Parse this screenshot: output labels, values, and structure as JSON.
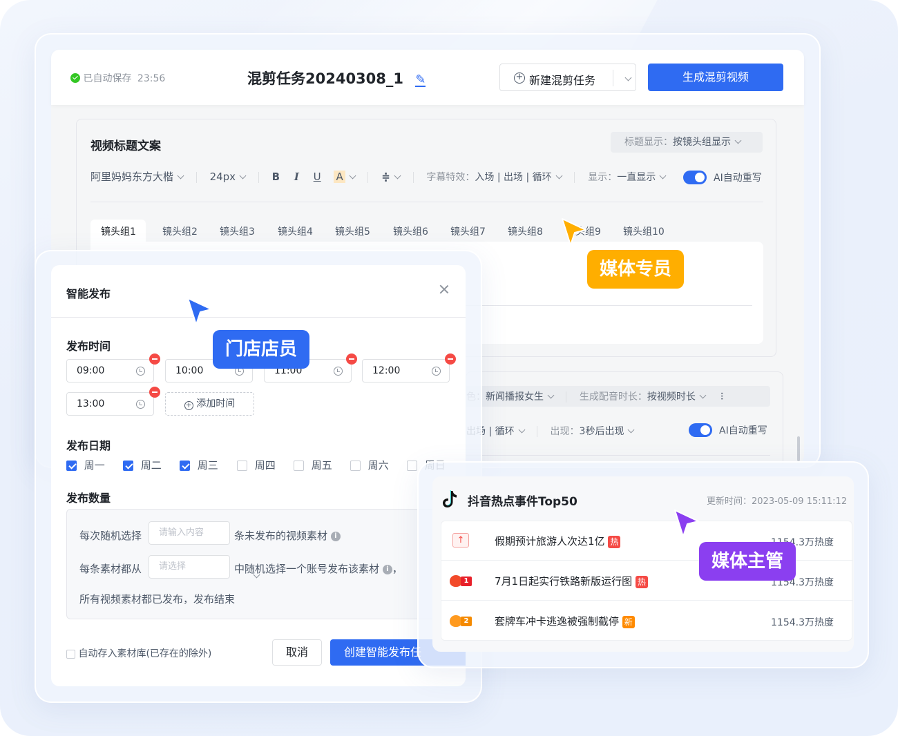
{
  "colors": {
    "primary": "#2f6bf2",
    "media_specialist": "#ffae00",
    "store_clerk": "#2f6bf2",
    "media_manager": "#8b3ff0",
    "danger": "#f54a45",
    "save_ok": "#34c724"
  },
  "header": {
    "autosave_text": "已自动保存",
    "autosave_time": "23:56",
    "task_title": "混剪任务20240308_1",
    "new_task_label": "新建混剪任务",
    "generate_label": "生成混剪视频"
  },
  "title_section": {
    "heading": "视频标题文案",
    "display_mode_label": "标题显示：",
    "display_mode_value": "按镜头组显示",
    "font_family": "阿里妈妈东方大楷",
    "font_size": "24px",
    "format_buttons": [
      "B",
      "I",
      "U",
      "A"
    ],
    "effect_label": "字幕特效：",
    "effect_value": "入场 | 出场 | 循环",
    "show_label": "显示：",
    "show_value": "一直显示",
    "ai_rewrite_label": "AI自动重写",
    "tabs": [
      "镜头组1",
      "镜头组2",
      "镜头组3",
      "镜头组4",
      "镜头组5",
      "镜头组6",
      "镜头组7",
      "镜头组8",
      "镜头组9",
      "镜头组10"
    ]
  },
  "voice_section": {
    "voice_label": "色：",
    "voice_value": "新闻播报女生",
    "duration_label": "生成配音时长：",
    "duration_value": "按视频时长",
    "effect_value": "出场 | 循环",
    "appear_label": "出现：",
    "appear_value": "3秒后出现",
    "ai_rewrite_label": "AI自动重写"
  },
  "publish_dialog": {
    "title": "智能发布",
    "time_heading": "发布时间",
    "times": [
      "09:00",
      "10:00",
      "11:00",
      "12:00",
      "13:00"
    ],
    "add_time_label": "添加时间",
    "date_heading": "发布日期",
    "weekdays": [
      {
        "label": "周一",
        "checked": true
      },
      {
        "label": "周二",
        "checked": true
      },
      {
        "label": "周三",
        "checked": true
      },
      {
        "label": "周四",
        "checked": false
      },
      {
        "label": "周五",
        "checked": false
      },
      {
        "label": "周六",
        "checked": false
      },
      {
        "label": "周日",
        "checked": false
      }
    ],
    "count_heading": "发布数量",
    "row1_prefix": "每次随机选择",
    "row1_placeholder": "请输入内容",
    "row1_suffix": "条未发布的视频素材",
    "row2_prefix": "每条素材都从",
    "row2_placeholder": "请选择",
    "row2_suffix": "中随机选择一个账号发布该素材",
    "row2_tail": "，",
    "row3_text": "所有视频素材都已发布，发布结束",
    "autosave_checkbox_label": "自动存入素材库(已存在的除外)",
    "cancel_label": "取消",
    "create_label": "创建智能发布任"
  },
  "hot_panel": {
    "title": "抖音热点事件Top50",
    "updated_label": "更新时间：",
    "updated_value": "2023-05-09   15:11:12",
    "items": [
      {
        "rank_icon": "pin",
        "text": "假期预计旅游人次达1亿",
        "badge": "热",
        "heat": "1154.3万热度"
      },
      {
        "rank_icon": "1",
        "text": "7月1日起实行铁路新版运行图",
        "badge": "热",
        "heat": "1154.3万热度"
      },
      {
        "rank_icon": "2",
        "text": "套牌车冲卡逃逸被强制截停",
        "badge": "新",
        "heat": "1154.3万热度"
      }
    ]
  },
  "role_tags": {
    "media_specialist": "媒体专员",
    "store_clerk": "门店店员",
    "media_manager": "媒体主管"
  }
}
